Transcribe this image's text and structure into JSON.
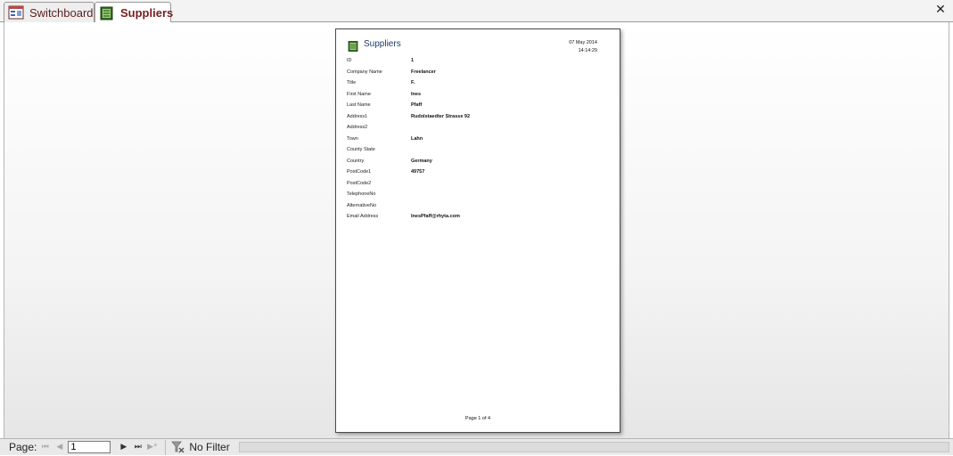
{
  "tabs": [
    {
      "label": "Switchboard",
      "icon": "switchboard-icon",
      "active": false
    },
    {
      "label": "Suppliers",
      "icon": "report-icon",
      "active": true
    }
  ],
  "close_label": "✕",
  "report": {
    "title": "Suppliers",
    "date": "07 May 2014",
    "time": "14:14:29",
    "fields": [
      {
        "label": "ID",
        "value": "1"
      },
      {
        "label": "Company Name",
        "value": "Freelancer"
      },
      {
        "label": "Title",
        "value": "F."
      },
      {
        "label": "First Name",
        "value": "Ines"
      },
      {
        "label": "Last Name",
        "value": "Pfaff"
      },
      {
        "label": "Address1",
        "value": "Rudolstaedter Strasse 92"
      },
      {
        "label": "Address2",
        "value": ""
      },
      {
        "label": "Town",
        "value": "Lahn"
      },
      {
        "label": "County State",
        "value": ""
      },
      {
        "label": "Country",
        "value": "Germany"
      },
      {
        "label": "PostCode1",
        "value": "49757"
      },
      {
        "label": "PostCode2",
        "value": ""
      },
      {
        "label": "TelephoneNo",
        "value": ""
      },
      {
        "label": "AlternativeNo",
        "value": ""
      },
      {
        "label": "Email Address",
        "value": "InesPfaff@rhyta.com"
      }
    ],
    "footer": "Page 1 of 4"
  },
  "statusbar": {
    "page_label": "Page:",
    "page_value": "1",
    "filter_label": "No Filter"
  },
  "colors": {
    "accent": "#7a1d1d",
    "title_blue": "#1f3b6b"
  }
}
